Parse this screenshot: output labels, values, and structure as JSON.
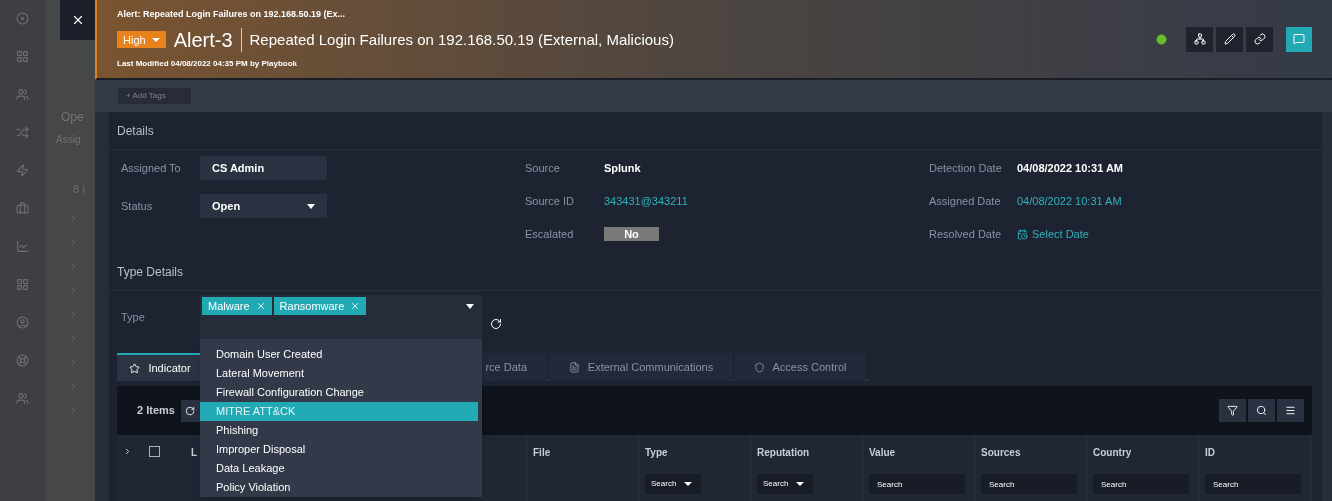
{
  "background_page": {
    "heading": "Ope",
    "subheading": "Assig",
    "count": "8 I"
  },
  "alert": {
    "breadcrumb": "Alert: Repeated Login Failures on 192.168.50.19 (Ex...",
    "severity": "High",
    "id": "Alert-3",
    "title": "Repeated Login Failures on 192.168.50.19 (External, Malicious)",
    "last_modified": "Last Modified 04/08/2022 04:35 PM by Playbook"
  },
  "add_tags": "+ Add Tags",
  "details": {
    "title": "Details",
    "columns": [
      [
        {
          "label": "Assigned To",
          "value": "CS Admin",
          "kind": "input"
        },
        {
          "label": "Status",
          "value": "Open",
          "kind": "select"
        }
      ],
      [
        {
          "label": "Source",
          "value": "Splunk",
          "kind": "text"
        },
        {
          "label": "Source ID",
          "value": "343431@343211",
          "kind": "link"
        },
        {
          "label": "Escalated",
          "value": "No",
          "kind": "toggle",
          "on": false
        }
      ],
      [
        {
          "label": "Detection Date",
          "value": "04/08/2022 10:31 AM",
          "kind": "text"
        },
        {
          "label": "Assigned Date",
          "value": "04/08/2022 10:31 AM",
          "kind": "link"
        },
        {
          "label": "Resolved Date",
          "value": "Select Date",
          "kind": "date"
        }
      ]
    ]
  },
  "type_details": {
    "title": "Type Details",
    "label": "Type",
    "tags": [
      "Malware",
      "Ransomware"
    ],
    "options": [
      {
        "label": "Domain User Created",
        "selected": false
      },
      {
        "label": "Lateral Movement",
        "selected": false
      },
      {
        "label": "Firewall Configuration Change",
        "selected": false
      },
      {
        "label": "MITRE ATT&CK",
        "selected": true
      },
      {
        "label": "Phishing",
        "selected": false
      },
      {
        "label": "Improper Disposal",
        "selected": false
      },
      {
        "label": "Data Leakage",
        "selected": false
      },
      {
        "label": "Policy Violation",
        "selected": false
      }
    ]
  },
  "tabs": [
    {
      "label": "Indicator",
      "selected": true
    },
    {
      "label": "rce Data",
      "selected": false
    },
    {
      "label": "External Communications",
      "selected": false
    },
    {
      "label": "Access Control",
      "selected": false
    }
  ],
  "table": {
    "count": "2 Items",
    "select_all_checked": false,
    "columns": [
      {
        "label": "L",
        "kind": "plain"
      },
      {
        "label": "File",
        "kind": "plain"
      },
      {
        "label": "Type",
        "kind": "select",
        "placeholder": "Search"
      },
      {
        "label": "Reputation",
        "kind": "select",
        "placeholder": "Search"
      },
      {
        "label": "Value",
        "kind": "text",
        "placeholder": "Search"
      },
      {
        "label": "Sources",
        "kind": "text",
        "placeholder": "Search"
      },
      {
        "label": "Country",
        "kind": "text",
        "placeholder": "Search"
      },
      {
        "label": "ID",
        "kind": "text",
        "placeholder": "Search"
      }
    ]
  }
}
